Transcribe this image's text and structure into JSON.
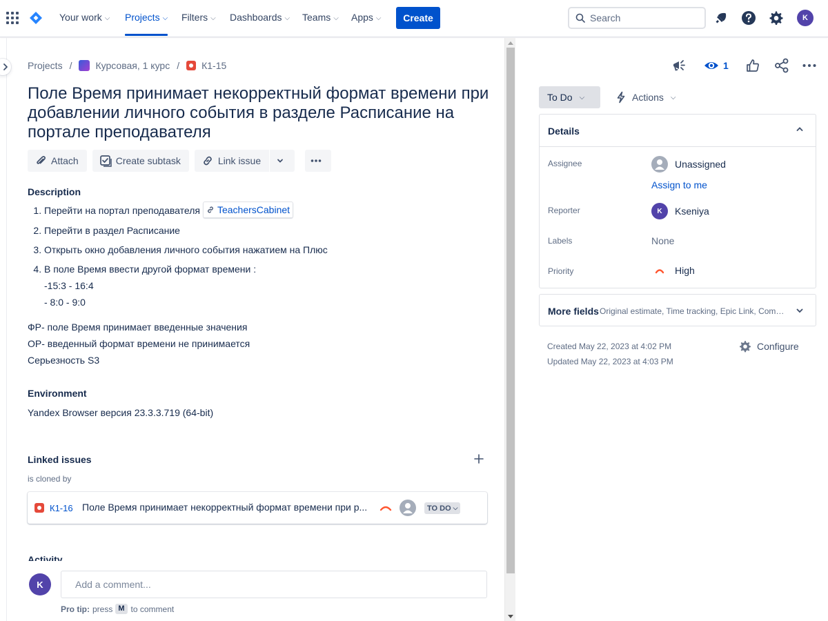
{
  "nav": {
    "items": [
      {
        "label": "Your work"
      },
      {
        "label": "Projects"
      },
      {
        "label": "Filters"
      },
      {
        "label": "Dashboards"
      },
      {
        "label": "Teams"
      },
      {
        "label": "Apps"
      }
    ],
    "active": "Projects",
    "create_label": "Create",
    "search_placeholder": "Search",
    "user_initial": "K",
    "icons": [
      "app-switcher-icon",
      "jira-logo-icon",
      "search-icon",
      "notifications-icon",
      "help-icon",
      "settings-icon"
    ]
  },
  "breadcrumb": {
    "root": "Projects",
    "project": "Курсовая, 1 курс",
    "issue_key": "К1-15"
  },
  "issue": {
    "title": "Поле Время принимает некорректный формат времени при добавлении личного события в разделе Расписание на портале преподавателя",
    "toolbar": {
      "attach": "Attach",
      "create_subtask": "Create subtask",
      "link_issue": "Link issue"
    },
    "description_heading": "Description",
    "steps": [
      "Перейти на портал преподавателя",
      "Перейти в раздел Расписание",
      "Открыть окно добавления личного события нажатием на Плюс",
      "В поле Время ввести другой формат времени :"
    ],
    "step1_link": "TeachersCabinet",
    "step4_lines": [
      "-15:3 - 16:4",
      "- 8:0 - 9:0"
    ],
    "result_lines": [
      "ФР- поле Время принимает введенные значения",
      "ОР- введенный формат времени не принимается",
      "Серьезность S3"
    ],
    "environment_heading": "Environment",
    "environment": "Yandex Browser версия 23.3.3.719 (64-bit)",
    "linked_heading": "Linked issues",
    "linked_relation": "is cloned by",
    "linked_issue": {
      "key": "К1-16",
      "summary": "Поле Время принимает некорректный формат времени при р...",
      "status": "TO DO"
    },
    "activity_heading": "Activity"
  },
  "comment": {
    "placeholder": "Add a comment...",
    "avatar_initial": "K",
    "pro_tip_label": "Pro tip:",
    "pro_tip_press": "press",
    "pro_tip_key": "M",
    "pro_tip_suffix": "to comment"
  },
  "right_panel": {
    "watch_count": "1",
    "status_label": "To Do",
    "actions_label": "Actions",
    "details_heading": "Details",
    "fields": {
      "assignee_label": "Assignee",
      "assignee_value": "Unassigned",
      "assign_to_me": "Assign to me",
      "reporter_label": "Reporter",
      "reporter_value": "Kseniya",
      "reporter_initial": "K",
      "labels_label": "Labels",
      "labels_value": "None",
      "priority_label": "Priority",
      "priority_value": "High"
    },
    "more_fields_label": "More fields",
    "more_fields_summary": "Original estimate, Time tracking, Epic Link, Components, Fix versions",
    "created": "Created May 22, 2023 at 4:02 PM",
    "updated": "Updated May 22, 2023 at 4:03 PM",
    "configure_label": "Configure"
  },
  "colors": {
    "brand": "#0052cc",
    "bug": "#e5493a",
    "priority_high": "#ff5630",
    "avatar": "#5243aa"
  }
}
